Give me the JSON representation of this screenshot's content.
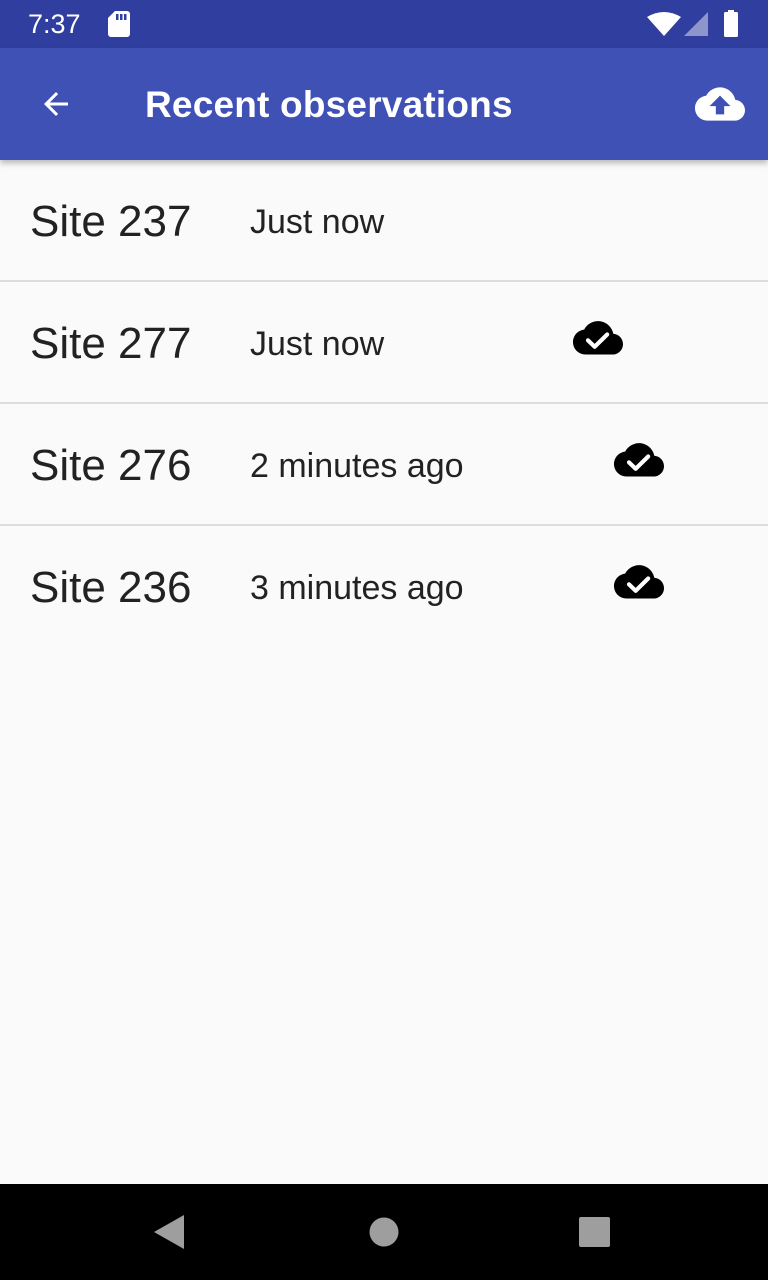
{
  "status_bar": {
    "time": "7:37"
  },
  "app_bar": {
    "title": "Recent observations",
    "back_icon": "arrow-back-icon",
    "action_icon": "cloud-upload-icon"
  },
  "observations": [
    {
      "site": "Site 237",
      "time": "Just now",
      "synced": false
    },
    {
      "site": "Site 277",
      "time": "Just now",
      "synced": true
    },
    {
      "site": "Site 276",
      "time": "2 minutes ago",
      "synced": true
    },
    {
      "site": "Site 236",
      "time": "3 minutes ago",
      "synced": true
    }
  ],
  "colors": {
    "status_bar": "#303f9f",
    "app_bar": "#3f51b5",
    "background": "#fafafa",
    "divider": "#dcdcdc",
    "text": "#222222",
    "nav_bar": "#000000"
  }
}
